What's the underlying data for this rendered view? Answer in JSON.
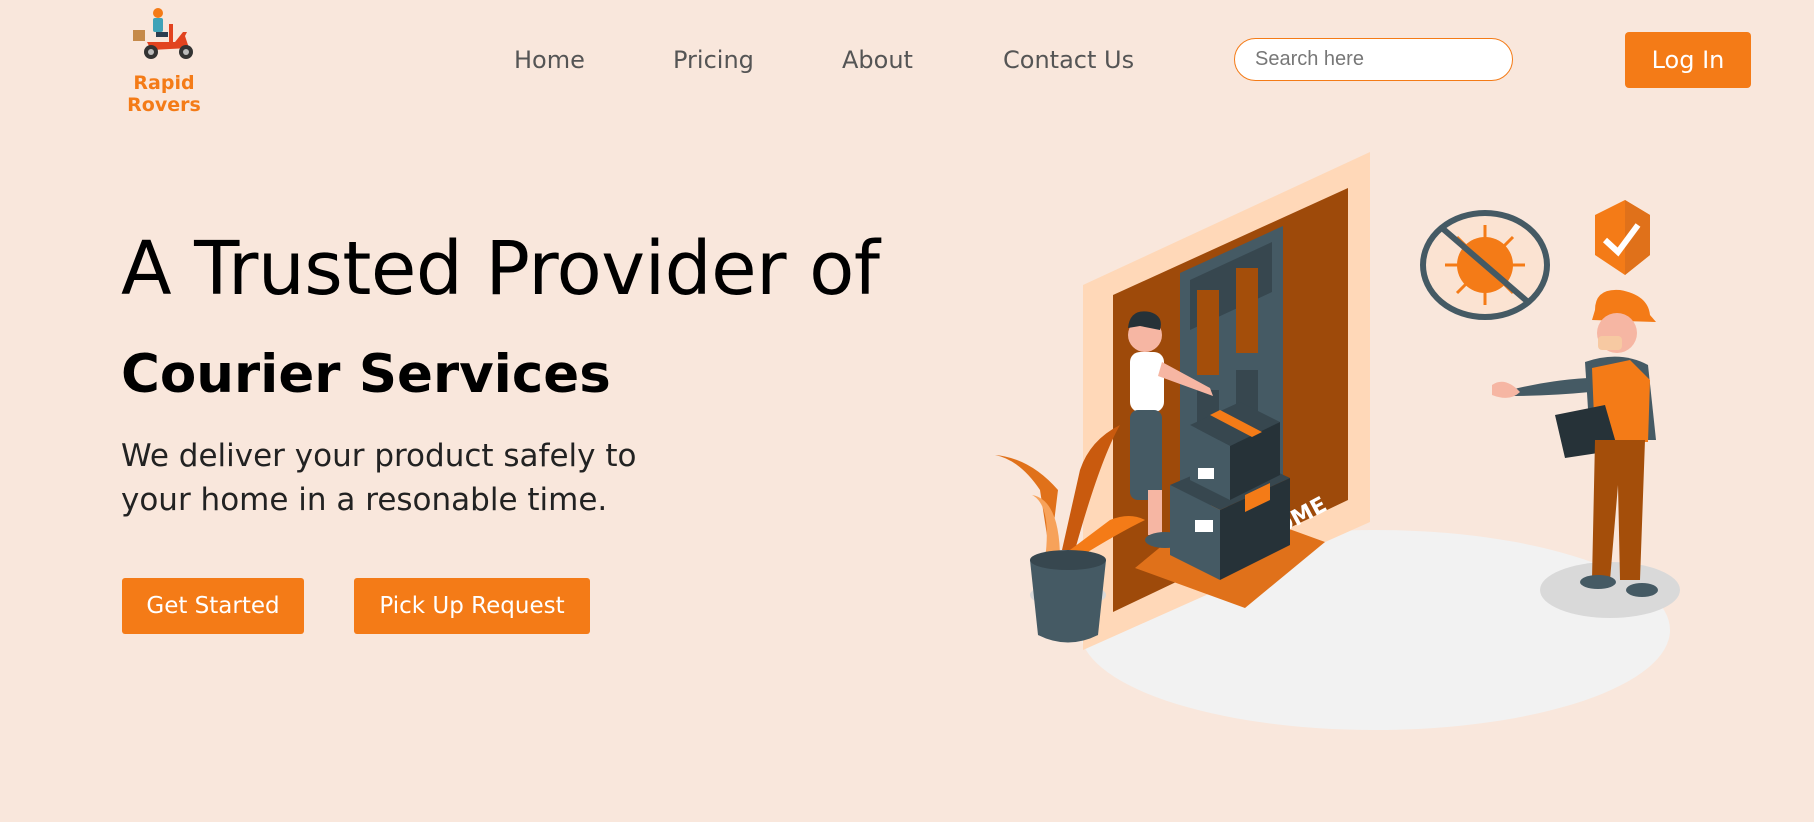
{
  "brand": {
    "name": "Rapid Rovers",
    "logo_icon": "scooter-courier-icon",
    "accent_color": "#f47b17",
    "background_color": "#f9e7dc"
  },
  "nav": {
    "items": [
      {
        "label": "Home"
      },
      {
        "label": "Pricing"
      },
      {
        "label": "About"
      },
      {
        "label": "Contact Us"
      }
    ]
  },
  "search": {
    "placeholder": "Search here",
    "value": ""
  },
  "header": {
    "login_label": "Log In"
  },
  "hero": {
    "headline": "A Trusted Provider of",
    "subheadline": "Courier Services",
    "description": "We deliver your product safely to your home in a resonable time.",
    "primary_button": "Get Started",
    "secondary_button": "Pick Up Request",
    "illustration": "courier-delivery-illustration",
    "doormat_text": "WELCOME"
  }
}
